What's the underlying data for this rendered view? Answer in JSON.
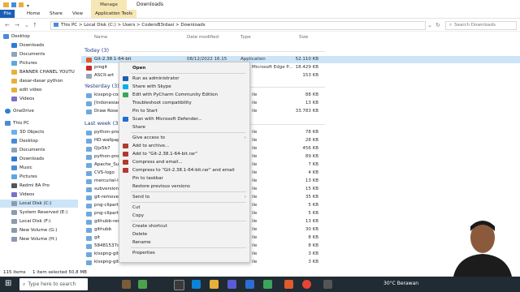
{
  "window": {
    "title": "Downloads",
    "manage_tab": "Manage",
    "app_tools_tab": "Application Tools"
  },
  "ribbon_tabs": [
    "File",
    "Home",
    "Share",
    "View"
  ],
  "address": {
    "crumbs": "This PC  >  Local Disk (C:)  >  Users  >  CodersB3rdasi  >  Downloads",
    "search_placeholder": "Search Downloads"
  },
  "nav": {
    "quick_access": [
      "Desktop",
      "Downloads",
      "Documents",
      "Pictures",
      "BANNER CHANEL YOUTU",
      "dasar-dasar python",
      "edit video",
      "Videos"
    ],
    "onedrive": "OneDrive",
    "this_pc": "This PC",
    "this_pc_items": [
      "3D Objects",
      "Desktop",
      "Documents",
      "Downloads",
      "Music",
      "Pictures",
      "Redmi 8A Pro",
      "Videos",
      "Local Disk (C:)",
      "System Reserved (E:)",
      "Local Disk (F:)",
      "New Volume (G:)",
      "New Volume (H:)"
    ]
  },
  "columns": {
    "name": "Name",
    "date": "Date modified",
    "type": "Type",
    "size": "Size"
  },
  "groups": {
    "today": "Today (3)",
    "yesterday": "Yesterday (3)",
    "last_week": "Last week (32)"
  },
  "today_rows": [
    {
      "name": "Git-2.38.1-64-bit",
      "date": "08/12/2022 16.15",
      "type": "Application",
      "size": "52.110 KB"
    },
    {
      "name": "progit",
      "date": "",
      "type": "Microsoft Edge P...",
      "size": "18.429 KB"
    },
    {
      "name": "ASCII-art",
      "date": "",
      "type": "",
      "size": "153 KB"
    }
  ],
  "yesterday_rows": [
    {
      "name": "kisspng-com",
      "type": "ile",
      "size": "88 KB"
    },
    {
      "name": "[Indonesian",
      "type": "ile",
      "size": "13 KB"
    },
    {
      "name": "Draw Rose F",
      "type": "ile",
      "size": "33.783 KB"
    }
  ],
  "last_week_rows": [
    {
      "name": "python-pro",
      "type": "ile",
      "size": "78 KB"
    },
    {
      "name": "HD-wallpap",
      "type": "ile",
      "size": "28 KB"
    },
    {
      "name": "Qjx5b7",
      "type": "ile",
      "size": "456 KB"
    },
    {
      "name": "python-pro",
      "type": "ile",
      "size": "89 KB"
    },
    {
      "name": "Apache_Sub",
      "type": "ile",
      "size": "7 KB"
    },
    {
      "name": "CVS-logo",
      "type": "ile",
      "size": "4 KB"
    },
    {
      "name": "mercurial-lo",
      "type": "ile",
      "size": "13 KB"
    },
    {
      "name": "subversion-",
      "type": "ile",
      "size": "15 KB"
    },
    {
      "name": "git-remove",
      "type": "ile",
      "size": "35 KB"
    },
    {
      "name": "png-clipart-",
      "type": "ile",
      "size": "5 KB"
    },
    {
      "name": "png-clipart-",
      "type": "ile",
      "size": "5 KB"
    },
    {
      "name": "githubb-ren",
      "type": "ile",
      "size": "13 KB"
    },
    {
      "name": "githubb",
      "type": "ile",
      "size": "30 KB"
    },
    {
      "name": "git",
      "type": "ile",
      "size": "8 KB"
    },
    {
      "name": "58481537ce",
      "type": "ile",
      "size": "8 KB"
    },
    {
      "name": "kisspng-git",
      "type": "ile",
      "size": "3 KB"
    },
    {
      "name": "kisspng-git",
      "type": "ile",
      "size": "3 KB"
    }
  ],
  "context_menu": [
    {
      "label": "Open",
      "bold": true
    },
    {
      "label": "Run as administrator"
    },
    {
      "label": "Share with Skype"
    },
    {
      "label": "Edit with PyCharm Community Edition"
    },
    {
      "label": "Troubleshoot compatibility"
    },
    {
      "label": "Pin to Start"
    },
    {
      "label": "Scan with Microsoft Defender..."
    },
    {
      "label": "Share"
    },
    {
      "label": "Give access to",
      "submenu": true
    },
    {
      "label": "Add to archive..."
    },
    {
      "label": "Add to \"Git-2.38.1-64-bit.rar\""
    },
    {
      "label": "Compress and email..."
    },
    {
      "label": "Compress to \"Git-2.38.1-64-bit.rar\" and email"
    },
    {
      "label": "Pin to taskbar"
    },
    {
      "label": "Restore previous versions"
    },
    {
      "label": "Send to",
      "submenu": true
    },
    {
      "label": "Cut"
    },
    {
      "label": "Copy"
    },
    {
      "label": "Create shortcut"
    },
    {
      "label": "Delete"
    },
    {
      "label": "Rename"
    },
    {
      "label": "Properties"
    }
  ],
  "status": {
    "count": "115 items",
    "selected": "1 item selected  50,8 MB"
  },
  "taskbar": {
    "search_placeholder": "Type here to search",
    "weather": "30°C  Berawan"
  },
  "colors": {
    "accent": "#1a5fb4",
    "selection": "#cce4f7",
    "taskbar": "#202b33",
    "manage": "#f6e7b4"
  }
}
